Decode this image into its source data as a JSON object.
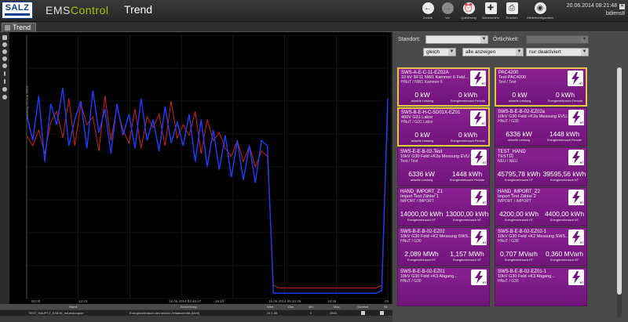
{
  "header": {
    "logo": "SALZ",
    "logo_sub": "",
    "app_name_a": "EMS",
    "app_name_b": "Control",
    "page_title": "Trend",
    "datetime": "20.06.2014 08:21:48",
    "user": "bdienstl",
    "buttons": [
      {
        "label": "Zurück",
        "icon": "back-arrow-icon"
      },
      {
        "label": "Vor",
        "icon": "forward-arrow-icon"
      },
      {
        "label": "Quittierung",
        "icon": "alarm-clock-icon"
      },
      {
        "label": "Alarmschirm",
        "icon": "alarm-screen-icon"
      },
      {
        "label": "Drucken",
        "icon": "printer-icon"
      },
      {
        "label": "Zählerkonfiguration",
        "icon": "meter-config-icon"
      }
    ]
  },
  "tab": {
    "label": "Trend"
  },
  "chart": {
    "y_label": "Leistung  15.Jun 2014",
    "x_ticks": [
      "00:00",
      "13:23",
      "18.06.2014 02:46:47",
      "16:10",
      "15.06.2014 05:33:35",
      "18:36",
      "03"
    ]
  },
  "chart_data": {
    "type": "line",
    "xlabel": "",
    "ylabel": "Leistung  15.Jun 2014",
    "x_ticks": [
      "00:00",
      "13:23",
      "18.06.2014 02:46:47",
      "16:10",
      "15.06.2014 05:33:35",
      "18:36",
      "03"
    ],
    "grid": true,
    "series": [
      {
        "color": "#d11f1f",
        "values": [
          0.62,
          0.58,
          0.64,
          0.55,
          0.67,
          0.71,
          0.61,
          0.76,
          0.58,
          0.74,
          0.66,
          0.69,
          0.56,
          0.77,
          0.6,
          0.73,
          0.64,
          0.59,
          0.72,
          0.57,
          0.69,
          0.65,
          0.7,
          0.58,
          0.75,
          0.61,
          0.66,
          0.62,
          0.71,
          0.55,
          0.68,
          0.6,
          0.63,
          0.57,
          0.54,
          0.6,
          0.52,
          0.58,
          0.5,
          0.56,
          0.54,
          0.05,
          0.04,
          0.04,
          0.04,
          0.04,
          0.04,
          0.04,
          0.04,
          0.04,
          0.04,
          0.04,
          0.04,
          0.04,
          0.04,
          0.04,
          0.04,
          0.04,
          0.04,
          0.05,
          0.72
        ]
      },
      {
        "color": "#1e3cff",
        "values": [
          0.7,
          0.6,
          0.77,
          0.52,
          0.74,
          0.66,
          0.8,
          0.58,
          0.68,
          0.75,
          0.57,
          0.79,
          0.63,
          0.72,
          0.55,
          0.74,
          0.62,
          0.7,
          0.57,
          0.76,
          0.6,
          0.68,
          0.56,
          0.73,
          0.59,
          0.67,
          0.58,
          0.7,
          0.52,
          0.68,
          0.5,
          0.64,
          0.49,
          0.62,
          0.46,
          0.6,
          0.45,
          0.58,
          0.44,
          0.6,
          0.58,
          0.02,
          0.02,
          0.02,
          0.02,
          0.02,
          0.02,
          0.02,
          0.02,
          0.02,
          0.02,
          0.02,
          0.02,
          0.02,
          0.02,
          0.02,
          0.02,
          0.02,
          0.02,
          0.03,
          0.76
        ]
      }
    ]
  },
  "table": {
    "headers": [
      "Name",
      "Bemerkung",
      "Wert",
      "Dim",
      "Min.",
      "Max.",
      "Sichtbar",
      "Sk"
    ],
    "row": [
      "TEST_HAUPTZ_E1B.IN_IstLeistungsnr",
      "Energieverbrauch des letzten Zeitabschnitts [kWh]",
      "24,1,06",
      "",
      "0",
      "2500",
      "",
      ""
    ]
  },
  "filters": {
    "standort_label": "Standort:",
    "standort_value": "",
    "ortlichkeit_label": "Örtlichkeit:",
    "ortlichkeit_value": "",
    "cmp_value": "gleich",
    "show_value": "alle anzeigen",
    "active_value": "nur deaktiviert"
  },
  "cards": [
    {
      "name": "SWS-A-E-C-11-EZ02A",
      "desc": "10 kV SF11 NW1 Kammer 6 Feld...",
      "loc": "HNuT / NW1 Kammer 6",
      "v1": "0 kW",
      "l1": "aktuelle Leistung",
      "v2": "0 kWh",
      "l2": "Energieverbrauch Periode",
      "badge": "HT",
      "gold": true
    },
    {
      "name": "PAC4200",
      "desc": "Test-PAC4200",
      "loc": "Test / Test",
      "v1": "0 kW",
      "l1": "aktuelle Leistung",
      "v2": "0 kWh",
      "l2": "Energieverbrauch Periode",
      "badge": "HT",
      "gold": true
    },
    {
      "name": "SWS-B-E-H-C-5G01X-EZ01",
      "desc": "400V G31 Labor",
      "loc": "HNuT / G31 Labor",
      "v1": "0 kW",
      "l1": "aktuelle Leistung",
      "v2": "0 kWh",
      "l2": "Energieverbrauch Periode",
      "badge": "HT",
      "gold": true
    },
    {
      "name": "SWS-B-E-B-02-EZ02a",
      "desc": "10kV G30 Feld +K2a Messung EVU...",
      "loc": "HNuT / G30",
      "v1": "6336 kW",
      "l1": "aktuelle Leistung",
      "v2": "1448 kWh",
      "l2": "Energieverbrauch Periode",
      "badge": "HT",
      "gold": false
    },
    {
      "name": "SWS-E-E-B-02-Test",
      "desc": "10kV G30 Feld +K2a Messung EVU...",
      "loc": "Test / Test",
      "v1": "6336 kW",
      "l1": "aktuelle Leistung",
      "v2": "1448 kWh",
      "l2": "Energieverbrauch Periode",
      "badge": "HT",
      "gold": false
    },
    {
      "name": "TEST_HAND",
      "desc": "TEST10",
      "loc": "NEU / NEU",
      "v1": "45795,78 kWh",
      "l1": "Energieverbrauch HT",
      "v2": "39595,56 kWh",
      "l2": "Energieverbrauch NT",
      "badge": "HT",
      "gold": false
    },
    {
      "name": "HAND_IMPORT_Z1",
      "desc": "Import Test Zähler 1",
      "loc": "IMPORT / IMPORT",
      "v1": "14000,00 kWh",
      "l1": "Energieverbrauch HT",
      "v2": "13000,00 kWh",
      "l2": "Energieverbrauch NT",
      "badge": "HT",
      "gold": false
    },
    {
      "name": "HAND_IMPORT_Z2",
      "desc": "Import Test Zähler 2",
      "loc": "IMPORT / IMPORT",
      "v1": "4200,00 kWh",
      "l1": "Energieverbrauch HT",
      "v2": "4400,00 kWh",
      "l2": "Energieverbrauch NT",
      "badge": "HT",
      "gold": false
    },
    {
      "name": "SWS-B-E-B-02-EZ02",
      "desc": "10kV G30 Feld +K2   Messung SWS...",
      "loc": "HNuT / G30",
      "v1": "2,089 MWh",
      "l1": "Energieverbrauch HT",
      "v2": "1,157 MWh",
      "l2": "Energieverbrauch NT",
      "badge": "HT",
      "gold": false
    },
    {
      "name": "SWS-B-E-B-02-EZ02-1",
      "desc": "10kV G30 Feld +K2   Messung SWS...",
      "loc": "HNuT / G30",
      "v1": "0,707 MVarh",
      "l1": "Energieverbrauch HT",
      "v2": "0,360 MVarh",
      "l2": "Energieverbrauch NT",
      "badge": "HT",
      "gold": false
    },
    {
      "name": "SWS-B-E-B-02-EZ01",
      "desc": "10kV G30 Feld +K3 Abgang...",
      "loc": "HNuT / G30",
      "v1": "",
      "l1": "",
      "v2": "",
      "l2": "",
      "badge": "HT",
      "gold": false
    },
    {
      "name": "SWS-B-E-B-02-EZ01-1",
      "desc": "10kV G30 Feld +K3 Abgang...",
      "loc": "HNuT / G30",
      "v1": "",
      "l1": "",
      "v2": "",
      "l2": "",
      "badge": "HT",
      "gold": false
    }
  ]
}
